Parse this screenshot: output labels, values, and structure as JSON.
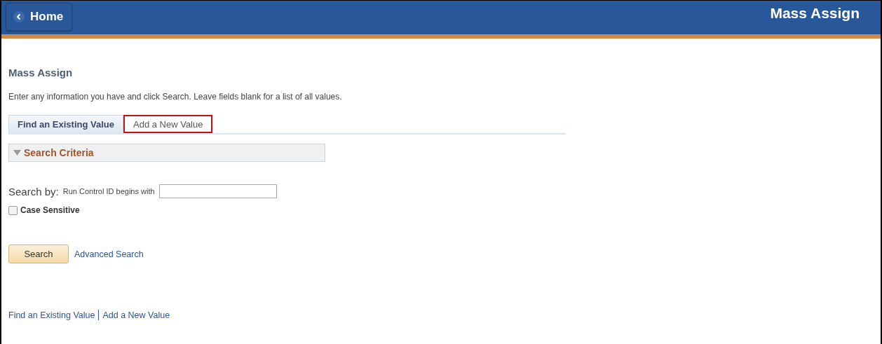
{
  "header": {
    "back_button": "Home",
    "title": "Mass Assign"
  },
  "page_title": "Mass Assign",
  "instructions": "Enter any information you have and click Search. Leave fields blank for a list of all values.",
  "tabs": [
    {
      "label": "Find an Existing Value",
      "selected": true,
      "highlighted": false
    },
    {
      "label": "Add a New Value",
      "selected": false,
      "highlighted": true
    }
  ],
  "section": {
    "title": "Search Criteria",
    "expanded": true
  },
  "search_by": {
    "label": "Search by:",
    "field_label": "Run Control ID begins with"
  },
  "case_sensitive": {
    "label": "Case Sensitive",
    "checked": false
  },
  "buttons": {
    "search": "Search",
    "advanced": "Advanced Search"
  },
  "footer_links": [
    "Find an Existing Value",
    "Add a New Value"
  ]
}
